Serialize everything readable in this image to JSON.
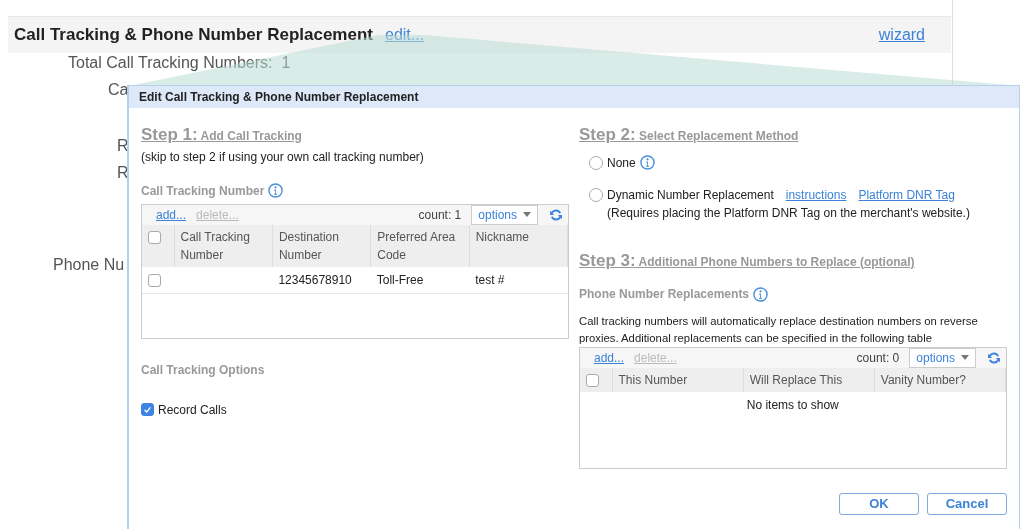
{
  "page": {
    "title": "Call Tracking & Phone Number Replacement",
    "edit_link": "edit...",
    "wizard_link": "wizard",
    "fields": [
      {
        "label": "Total Call Tracking Numbers:",
        "value": "1"
      },
      {
        "label": "Ca"
      },
      {
        "label": "R"
      },
      {
        "label": "R"
      },
      {
        "label": "Phone Nu"
      }
    ]
  },
  "dialog": {
    "title": "Edit Call Tracking & Phone Number Replacement",
    "step1": {
      "step": "Step 1:",
      "heading": "Add Call Tracking",
      "note": "(skip to step 2 if using your own call tracking number)",
      "grid": {
        "title": "Call Tracking Number",
        "add": "add...",
        "delete": {
          "label": "delete...",
          "disabled": true
        },
        "count": "count: 1",
        "options": "options",
        "header_checked": false,
        "columns": [
          "Call Tracking Number",
          "Destination Number",
          "Preferred Area Code",
          "Nickname"
        ],
        "rows": [
          {
            "checked": false,
            "cells": [
              null,
              "12345678910",
              "Toll-Free",
              "test #"
            ]
          }
        ]
      },
      "options_title": "Call Tracking Options",
      "options": [
        {
          "label": "Record Calls",
          "checked": true
        }
      ]
    },
    "step2": {
      "step": "Step 2:",
      "heading": "Select Replacement Method",
      "methods": [
        {
          "label": "None",
          "selected": false,
          "info": true
        },
        {
          "label": "Dynamic Number Replacement",
          "selected": false,
          "links": [
            "instructions",
            "Platform DNR Tag"
          ],
          "note": "(Requires placing the Platform DNR Tag on the merchant's website.)"
        }
      ]
    },
    "step3": {
      "step": "Step 3:",
      "heading": "Additional Phone Numbers to Replace (optional)",
      "description": "Call tracking numbers will automatically replace destination numbers on reverse proxies. Additional replacements can be specified in the following table",
      "grid": {
        "title": "Phone Number Replacements",
        "add": "add...",
        "delete": {
          "label": "delete...",
          "disabled": true
        },
        "count": "count: 0",
        "options": "options",
        "header_checked": false,
        "columns": [
          "This Number",
          "Will Replace This",
          "Vanity Number?"
        ],
        "empty": "No items to show"
      }
    },
    "buttons": [
      "OK",
      "Cancel"
    ]
  }
}
